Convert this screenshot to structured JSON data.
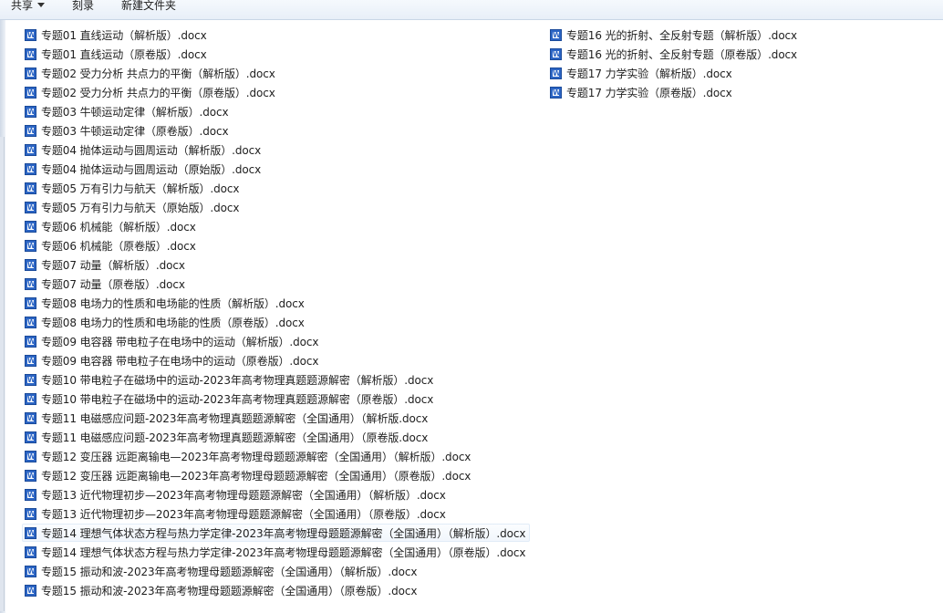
{
  "toolbar": {
    "share_label": "共享",
    "burn_label": "刻录",
    "new_folder_label": "新建文件夹"
  },
  "files": [
    "专题01 直线运动（解析版）.docx",
    "专题01 直线运动（原卷版）.docx",
    "专题02 受力分析 共点力的平衡（解析版）.docx",
    "专题02 受力分析 共点力的平衡（原卷版）.docx",
    "专题03 牛顿运动定律（解析版）.docx",
    "专题03 牛顿运动定律（原卷版）.docx",
    "专题04 抛体运动与圆周运动（解析版）.docx",
    "专题04 抛体运动与圆周运动（原始版）.docx",
    "专题05 万有引力与航天（解析版）.docx",
    "专题05 万有引力与航天（原始版）.docx",
    "专题06 机械能（解析版）.docx",
    "专题06 机械能（原卷版）.docx",
    "专题07 动量（解析版）.docx",
    "专题07 动量（原卷版）.docx",
    "专题08 电场力的性质和电场能的性质（解析版）.docx",
    "专题08 电场力的性质和电场能的性质（原卷版）.docx",
    "专题09  电容器 带电粒子在电场中的运动（解析版）.docx",
    "专题09  电容器 带电粒子在电场中的运动（原卷版）.docx",
    "专题10 带电粒子在磁场中的运动-2023年高考物理真题题源解密（解析版）.docx",
    "专题10 带电粒子在磁场中的运动-2023年高考物理真题题源解密（原卷版）.docx",
    "专题11 电磁感应问题-2023年高考物理真题题源解密（全国通用）（解析版.docx",
    "专题11 电磁感应问题-2023年高考物理真题题源解密（全国通用）（原卷版.docx",
    "专题12 变压器 远距离输电—2023年高考物理母题题源解密（全国通用）（解析版）.docx",
    "专题12 变压器 远距离输电—2023年高考物理母题题源解密（全国通用）（原卷版）.docx",
    "专题13 近代物理初步—2023年高考物理母题题源解密（全国通用）（解析版）.docx",
    "专题13 近代物理初步—2023年高考物理母题题源解密（全国通用）（原卷版）.docx",
    "专题14 理想气体状态方程与热力学定律-2023年高考物理母题题源解密（全国通用）（解析版）.docx",
    "专题14 理想气体状态方程与热力学定律-2023年高考物理母题题源解密（全国通用）（原卷版）.docx",
    "专题15  振动和波-2023年高考物理母题题源解密（全国通用）（解析版）.docx",
    "专题15  振动和波-2023年高考物理母题题源解密（全国通用）（原卷版）.docx",
    "专题16  光的折射、全反射专题（解析版）.docx",
    "专题16  光的折射、全反射专题（原卷版）.docx",
    "专题17  力学实验（解析版）.docx",
    "专题17  力学实验（原卷版）.docx"
  ],
  "hovered_file": "专题14 理想气体状态方程与热力学定律-2023年高考物理母题题源解密（全国通用）（解析版）.docx",
  "colors": {
    "toolbar_bg": "#e8eff8",
    "word_icon": "#2c65c4",
    "hover_bg": "#f1f6fc"
  },
  "icons": {
    "file_icon": "word-document-icon",
    "share_dropdown": "chevron-down-icon"
  }
}
